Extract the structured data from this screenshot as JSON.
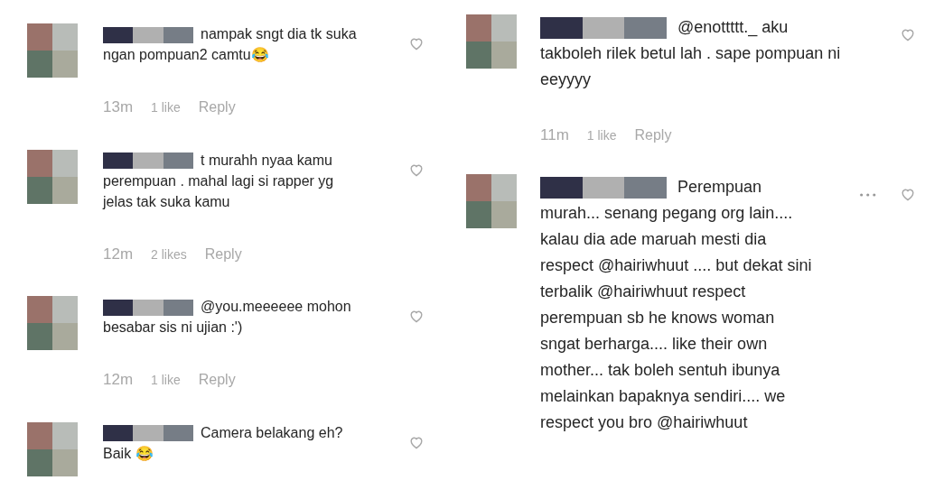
{
  "columns": [
    {
      "comments": [
        {
          "text": "nampak sngt dia tk suka ngan pompuan2 camtu😂",
          "time": "13m",
          "likes": "1 like",
          "reply": "Reply",
          "more_button": false
        },
        {
          "text": "t murahh nyaa kamu perempuan . mahal lagi si rapper yg jelas tak suka kamu",
          "time": "12m",
          "likes": "2 likes",
          "reply": "Reply",
          "more_button": false
        },
        {
          "text": "@you.meeeeee mohon besabar sis ni ujian :')",
          "time": "12m",
          "likes": "1 like",
          "reply": "Reply",
          "more_button": false
        },
        {
          "text": "Camera belakang eh? Baik 😂",
          "more_button": false
        }
      ]
    },
    {
      "comments": [
        {
          "text": "@enottttt._ aku takboleh rilek betul lah . sape pompuan ni eeyyyy",
          "time": "11m",
          "likes": "1 like",
          "reply": "Reply",
          "more_button": false
        },
        {
          "text": "Perempuan murah... senang pegang org lain.... kalau dia ade maruah mesti dia respect @hairiwhuut .... but dekat sini terbalik @hairiwhuut respect perempuan sb he knows woman sngat berharga.... like their own mother... tak boleh sentuh ibunya melainkan bapaknya sendiri.... we respect you bro @hairiwhuut",
          "more_button": true
        }
      ]
    }
  ]
}
